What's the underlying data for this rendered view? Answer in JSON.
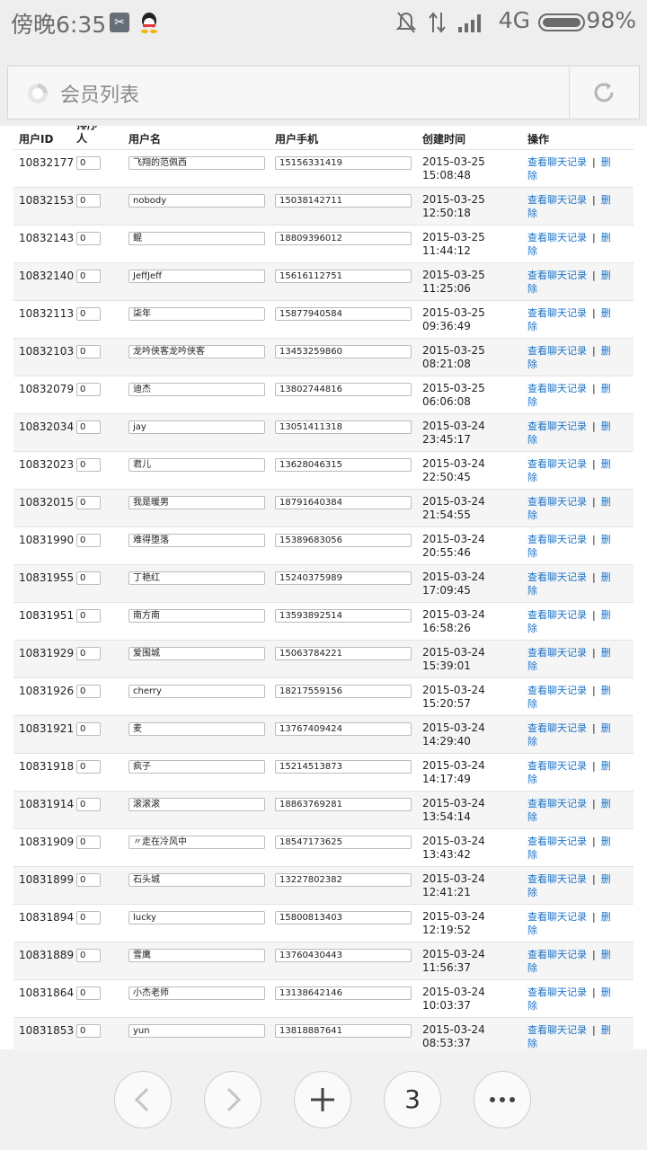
{
  "status_bar": {
    "time": "傍晚6:35",
    "network": "4G",
    "battery": "98%",
    "icons": [
      "app-icon",
      "qq-icon",
      "mute-icon",
      "data-transfer-icon",
      "signal-icon",
      "battery-icon"
    ]
  },
  "browser": {
    "page_title": "会员列表",
    "tab_count": "3"
  },
  "table": {
    "headers": {
      "id": "用户ID",
      "sort_cut": "排序\n人",
      "name": "用户名",
      "phone": "用户手机",
      "created": "创建时间",
      "ops": "操作"
    },
    "view_chat_label": "查看聊天记录",
    "separator": "|",
    "delete_label_1": "删",
    "delete_label_2": "除",
    "rows": [
      {
        "id": "10832177",
        "sort": "0",
        "name": "飞翔的范佩西",
        "phone": "15156331419",
        "date": "2015-03-25",
        "time": "15:08:48"
      },
      {
        "id": "10832153",
        "sort": "0",
        "name": "nobody",
        "phone": "15038142711",
        "date": "2015-03-25",
        "time": "12:50:18"
      },
      {
        "id": "10832143",
        "sort": "0",
        "name": "鲲",
        "phone": "18809396012",
        "date": "2015-03-25",
        "time": "11:44:12"
      },
      {
        "id": "10832140",
        "sort": "0",
        "name": "JeffJeff",
        "phone": "15616112751",
        "date": "2015-03-25",
        "time": "11:25:06"
      },
      {
        "id": "10832113",
        "sort": "0",
        "name": "柒年",
        "phone": "15877940584",
        "date": "2015-03-25",
        "time": "09:36:49"
      },
      {
        "id": "10832103",
        "sort": "0",
        "name": "龙吟侠客龙吟侠客",
        "phone": "13453259860",
        "date": "2015-03-25",
        "time": "08:21:08"
      },
      {
        "id": "10832079",
        "sort": "0",
        "name": "迪杰",
        "phone": "13802744816",
        "date": "2015-03-25",
        "time": "06:06:08"
      },
      {
        "id": "10832034",
        "sort": "0",
        "name": "jay",
        "phone": "13051411318",
        "date": "2015-03-24",
        "time": "23:45:17"
      },
      {
        "id": "10832023",
        "sort": "0",
        "name": "君儿",
        "phone": "13628046315",
        "date": "2015-03-24",
        "time": "22:50:45"
      },
      {
        "id": "10832015",
        "sort": "0",
        "name": "我是暖男",
        "phone": "18791640384",
        "date": "2015-03-24",
        "time": "21:54:55"
      },
      {
        "id": "10831990",
        "sort": "0",
        "name": "难得堕落",
        "phone": "15389683056",
        "date": "2015-03-24",
        "time": "20:55:46"
      },
      {
        "id": "10831955",
        "sort": "0",
        "name": "丁艳红",
        "phone": "15240375989",
        "date": "2015-03-24",
        "time": "17:09:45"
      },
      {
        "id": "10831951",
        "sort": "0",
        "name": "南方南",
        "phone": "13593892514",
        "date": "2015-03-24",
        "time": "16:58:26"
      },
      {
        "id": "10831929",
        "sort": "0",
        "name": "爱围城",
        "phone": "15063784221",
        "date": "2015-03-24",
        "time": "15:39:01"
      },
      {
        "id": "10831926",
        "sort": "0",
        "name": "cherry",
        "phone": "18217559156",
        "date": "2015-03-24",
        "time": "15:20:57"
      },
      {
        "id": "10831921",
        "sort": "0",
        "name": "麦",
        "phone": "13767409424",
        "date": "2015-03-24",
        "time": "14:29:40"
      },
      {
        "id": "10831918",
        "sort": "0",
        "name": "疯子",
        "phone": "15214513873",
        "date": "2015-03-24",
        "time": "14:17:49"
      },
      {
        "id": "10831914",
        "sort": "0",
        "name": "滚滚滚",
        "phone": "18863769281",
        "date": "2015-03-24",
        "time": "13:54:14"
      },
      {
        "id": "10831909",
        "sort": "0",
        "name": "〃走在冷风中",
        "phone": "18547173625",
        "date": "2015-03-24",
        "time": "13:43:42"
      },
      {
        "id": "10831899",
        "sort": "0",
        "name": "石头城",
        "phone": "13227802382",
        "date": "2015-03-24",
        "time": "12:41:21"
      },
      {
        "id": "10831894",
        "sort": "0",
        "name": "lucky",
        "phone": "15800813403",
        "date": "2015-03-24",
        "time": "12:19:52"
      },
      {
        "id": "10831889",
        "sort": "0",
        "name": "雪鹰",
        "phone": "13760430443",
        "date": "2015-03-24",
        "time": "11:56:37"
      },
      {
        "id": "10831864",
        "sort": "0",
        "name": "小杰老师",
        "phone": "13138642146",
        "date": "2015-03-24",
        "time": "10:03:37"
      },
      {
        "id": "10831853",
        "sort": "0",
        "name": "yun",
        "phone": "13818887641",
        "date": "2015-03-24",
        "time": "08:53:37"
      }
    ]
  },
  "colors": {
    "link": "#1a73c9",
    "status_bar_bg": "#eeeeee",
    "row_alt_bg": "#f5f5f5"
  }
}
